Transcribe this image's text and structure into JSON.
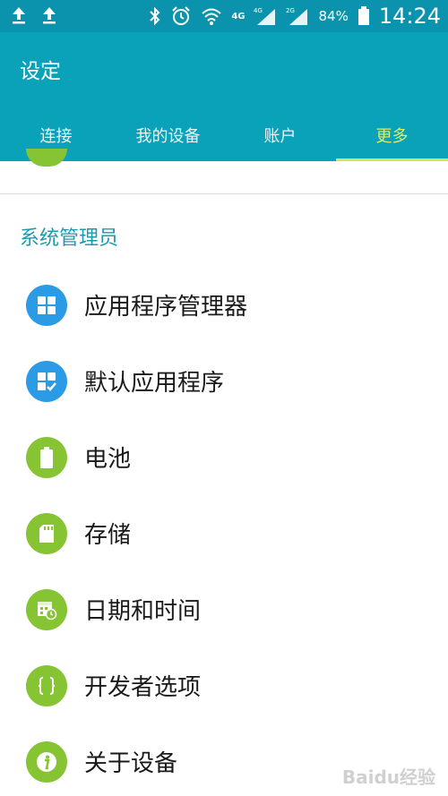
{
  "status_bar": {
    "time": "14:24",
    "battery": "84%",
    "network_1": "4G",
    "network_2": "4G",
    "network_3": "2G"
  },
  "app_bar": {
    "title": "设定",
    "tabs": [
      {
        "label": "连接"
      },
      {
        "label": "我的设备"
      },
      {
        "label": "账户"
      },
      {
        "label": "更多"
      }
    ]
  },
  "section": {
    "header": "系统管理员",
    "items": [
      {
        "label": "应用程序管理器",
        "icon": "apps-grid-icon",
        "color": "#2c9be6"
      },
      {
        "label": "默认应用程序",
        "icon": "default-apps-icon",
        "color": "#2c9be6"
      },
      {
        "label": "电池",
        "icon": "battery-icon",
        "color": "#86c434"
      },
      {
        "label": "存储",
        "icon": "sd-card-icon",
        "color": "#86c434"
      },
      {
        "label": "日期和时间",
        "icon": "calendar-clock-icon",
        "color": "#86c434"
      },
      {
        "label": "开发者选项",
        "icon": "braces-icon",
        "color": "#86c434"
      },
      {
        "label": "关于设备",
        "icon": "info-icon",
        "color": "#86c434"
      }
    ]
  },
  "watermark": "Baidu经验",
  "colors": {
    "status_bar": "#0b93ad",
    "app_bar": "#0aa2b8",
    "active_tab": "#d8ef6a",
    "section_header": "#1c9bb0"
  }
}
